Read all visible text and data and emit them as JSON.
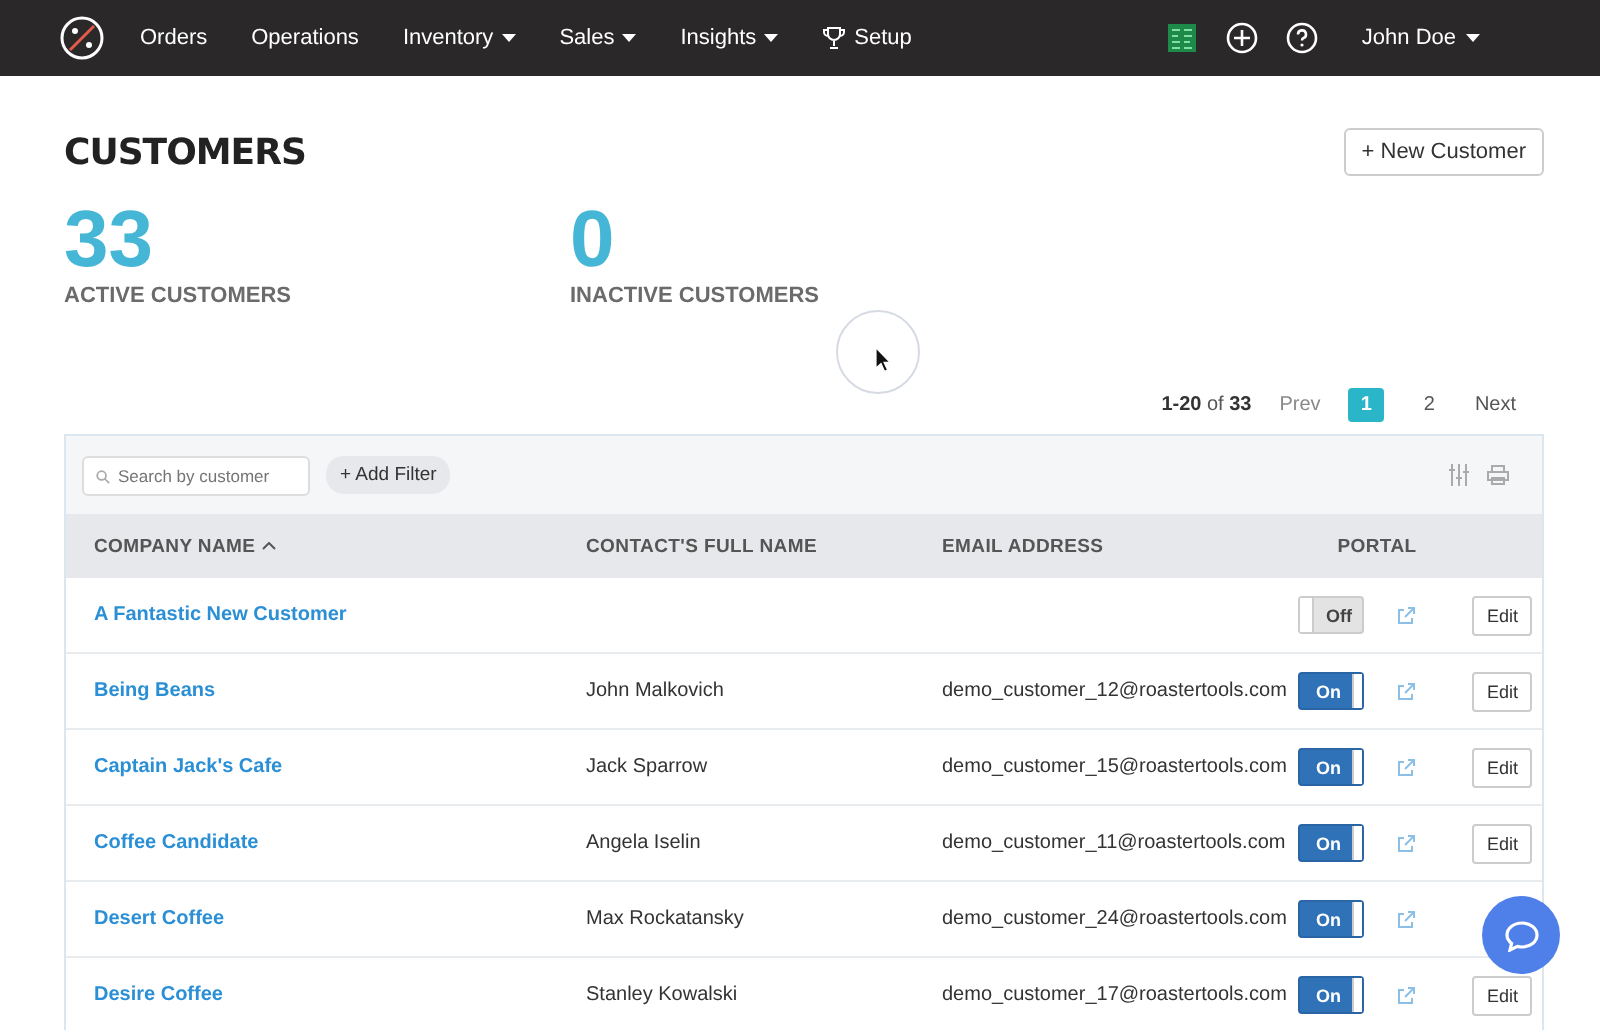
{
  "nav": {
    "items": [
      {
        "label": "Orders",
        "dropdown": false,
        "kind": "link"
      },
      {
        "label": "Operations",
        "dropdown": false,
        "kind": "link"
      },
      {
        "label": "Inventory",
        "dropdown": true,
        "kind": "link"
      },
      {
        "label": "Sales",
        "dropdown": true,
        "kind": "link"
      },
      {
        "label": "Insights",
        "dropdown": true,
        "kind": "link"
      },
      {
        "label": "Setup",
        "dropdown": false,
        "kind": "trophy"
      }
    ],
    "user": "John Doe"
  },
  "page": {
    "title": "CUSTOMERS",
    "new_button": "+ New Customer"
  },
  "stats": [
    {
      "value": "33",
      "label": "ACTIVE CUSTOMERS"
    },
    {
      "value": "0",
      "label": "INACTIVE CUSTOMERS"
    }
  ],
  "pagination": {
    "range": "1-20",
    "of": "of",
    "total": "33",
    "prev": "Prev",
    "pages": [
      {
        "label": "1",
        "selected": true
      },
      {
        "label": "2",
        "selected": false
      }
    ],
    "next": "Next"
  },
  "toolbar": {
    "search": {
      "placeholder": "Search by customer"
    },
    "filter_button": "+ Add Filter"
  },
  "table": {
    "columns": [
      "COMPANY NAME",
      "CONTACT'S FULL NAME",
      "EMAIL ADDRESS",
      "PORTAL"
    ],
    "rows": [
      {
        "company": "A Fantastic New Customer",
        "contact": "",
        "email": "",
        "portal": "Off",
        "portal_on": false,
        "edit": "Edit"
      },
      {
        "company": "Being Beans",
        "contact": "John Malkovich",
        "email": "demo_customer_12@roastertools.com",
        "portal": "On",
        "portal_on": true,
        "edit": "Edit"
      },
      {
        "company": "Captain Jack's Cafe",
        "contact": "Jack Sparrow",
        "email": "demo_customer_15@roastertools.com",
        "portal": "On",
        "portal_on": true,
        "edit": "Edit"
      },
      {
        "company": "Coffee Candidate",
        "contact": "Angela Iselin",
        "email": "demo_customer_11@roastertools.com",
        "portal": "On",
        "portal_on": true,
        "edit": "Edit"
      },
      {
        "company": "Desert Coffee",
        "contact": "Max Rockatansky",
        "email": "demo_customer_24@roastertools.com",
        "portal": "On",
        "portal_on": true
      },
      {
        "company": "Desire Coffee",
        "contact": "Stanley Kowalski",
        "email": "demo_customer_17@roastertools.com",
        "portal": "On",
        "portal_on": true,
        "edit": "Edit"
      }
    ]
  }
}
